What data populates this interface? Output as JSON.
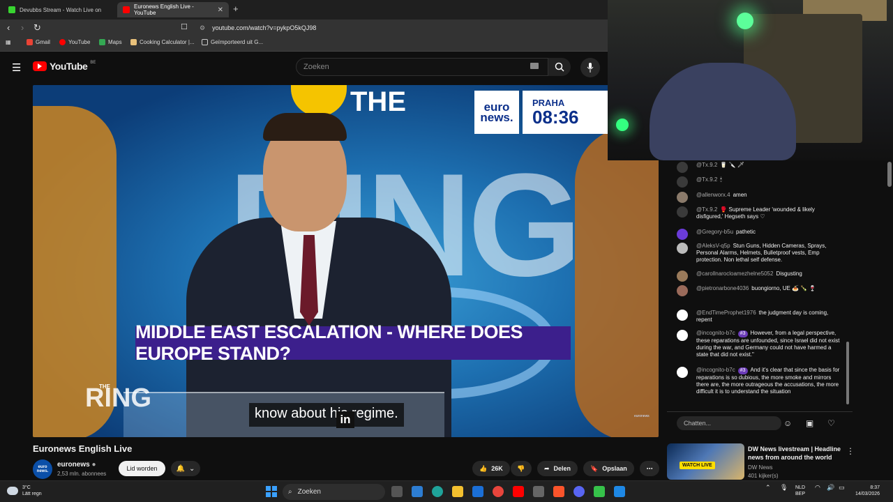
{
  "browser": {
    "tabs": [
      {
        "label": "Devubbs Stream - Watch Live on",
        "color": "#38d430"
      },
      {
        "label": "Euronews English Live - YouTube",
        "color": "#ff0000"
      }
    ],
    "url": "youtube.com/watch?v=pykpO5kQJ98",
    "bookmarks": [
      "Gmail",
      "YouTube",
      "Maps",
      "Cooking Calculator |...",
      "Geïmporteerd uit G..."
    ]
  },
  "youtube": {
    "logo_text": "YouTube",
    "region": "BE",
    "search_placeholder": "Zoeken"
  },
  "video": {
    "show_title": "THE",
    "show_word": "RING",
    "euronews_logo": "euro news.",
    "city": "PRAHA",
    "time": "08:36",
    "headline": "MIDDLE EAST ESCALATION - WHERE DOES EUROPE STAND?",
    "subtitle": "know about his regime.",
    "li": "in",
    "small_the": "THE",
    "small_ring": "RING",
    "corner_badge": "euronews"
  },
  "chat": {
    "messages": [
      {
        "author": "@Tx.9.2",
        "text": "🥛 🔪 🗡",
        "badge": ""
      },
      {
        "author": "@Tx.9.2",
        "text": "🕯",
        "badge": ""
      },
      {
        "author": "@allenworx.4",
        "text": "amen",
        "badge": ""
      },
      {
        "author": "@Tx.9.2",
        "text": "🥊 Supreme Leader 'wounded & likely disfigured,' Hegseth says ♡",
        "badge": ""
      },
      {
        "author": "@Gregory-b5u",
        "text": "pathetic",
        "badge": ""
      },
      {
        "author": "@AleksV-q5p",
        "text": "Stun Guns, Hidden Cameras, Sprays, Personal Alarms, Helmets, Bulletproof vests, Emp protection. Non lethal self defense.",
        "badge": ""
      },
      {
        "author": "@carollnarocloamezhelne5052",
        "text": "Disgusting",
        "badge": ""
      },
      {
        "author": "@pietronarbone4036",
        "text": "buongiorno, UE 🍝 🍾 🍷",
        "badge": ""
      },
      {
        "author": "@EndTimeProphet1976",
        "text": "the judgment day is coming, repent",
        "badge": ""
      },
      {
        "author": "@incognito-b7c",
        "text": "However, from a legal perspective, these reparations are unfounded, since Israel did not exist during the war, and Germany could not have harmed a state that did not exist.\"",
        "badge": "#3"
      },
      {
        "author": "@incognito-b7c",
        "text": "And it's clear that since the basis for reparations is so dubious, the more smoke and mirrors there are, the more outrageous the accusations, the more difficult it is to understand the situation",
        "badge": "#3"
      }
    ],
    "input_placeholder": "Chatten..."
  },
  "video_info": {
    "title": "Euronews English Live",
    "channel": "euronews",
    "channel_avatar": "euro news.",
    "subscribers": "2,53 mln. abonnees",
    "join_label": "Lid worden",
    "likes": "26K",
    "share_label": "Delen",
    "save_label": "Opslaan"
  },
  "related": {
    "title": "DW News livestream | Headline news from around the world",
    "channel": "DW News",
    "viewers": "401 kijker(s)",
    "live_label": "WATCH LIVE"
  },
  "taskbar": {
    "temp": "3°C",
    "weather": "Lätt regn",
    "search": "Zoeken",
    "lang_top": "NLD",
    "lang_bottom": "BEP",
    "time": "8:37",
    "date": "14/03/2026"
  },
  "colors": {
    "accent_red": "#ff0000",
    "headline_bg": "#3c1f8c",
    "euronews_blue": "#0b2f8a"
  }
}
